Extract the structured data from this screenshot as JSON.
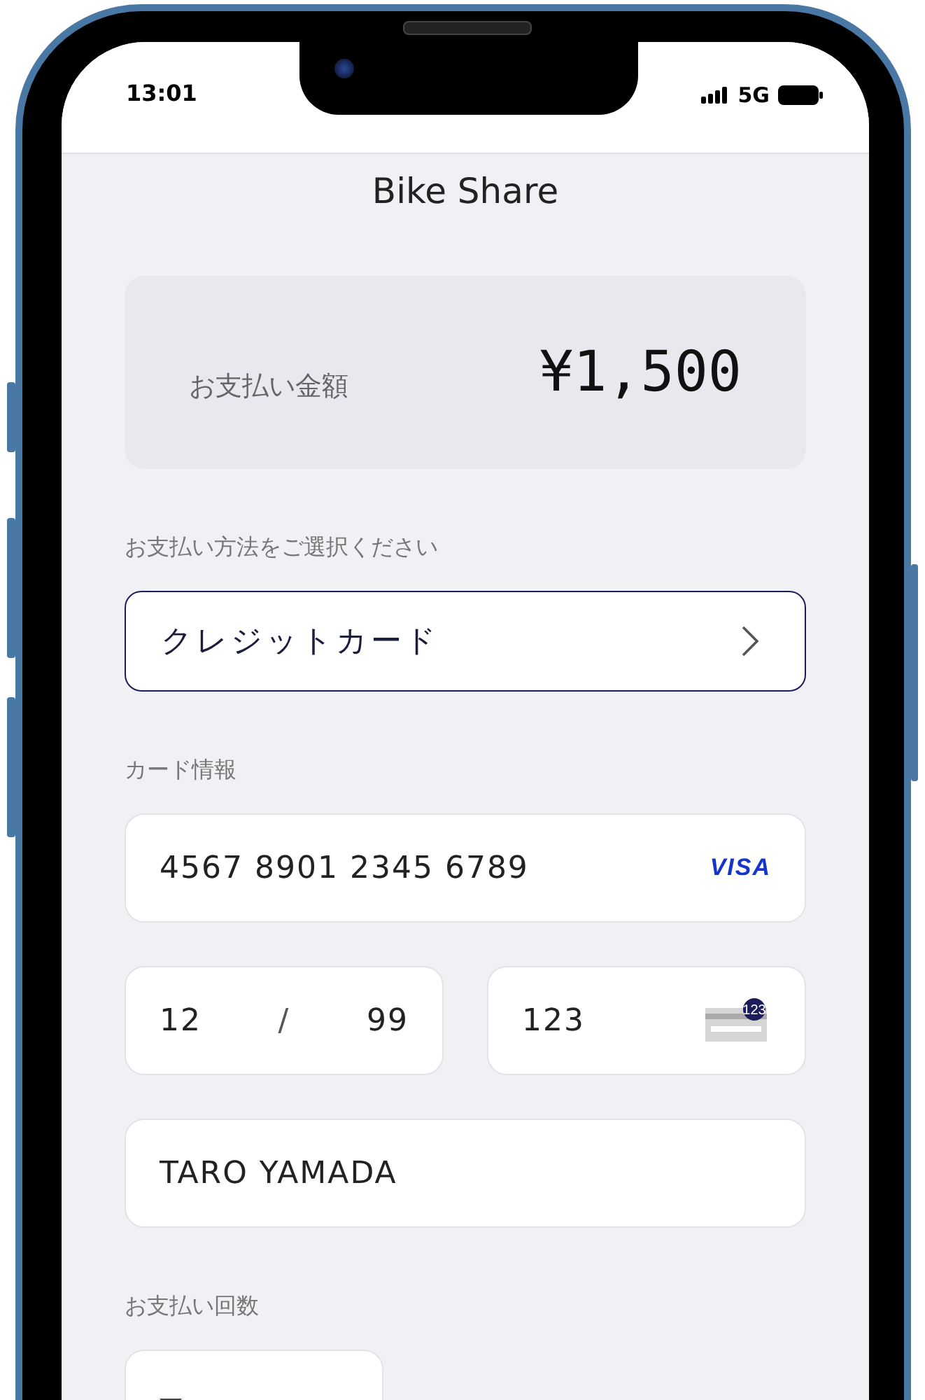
{
  "status_bar": {
    "time": "13:01",
    "network": "5G"
  },
  "header": {
    "title": "Bike Share"
  },
  "amount": {
    "label": "お支払い金額",
    "value": "¥1,500"
  },
  "payment_method": {
    "label": "お支払い方法をご選択ください",
    "value": "クレジットカード"
  },
  "card": {
    "label": "カード情報",
    "number": "4567 8901 2345 6789",
    "brand": "VISA",
    "expiry_month": "12",
    "separator": "/",
    "expiry_year": "99",
    "cvc": "123",
    "cvc_badge": "123",
    "name": "TARO YAMADA"
  },
  "installments": {
    "label": "お支払い回数"
  }
}
